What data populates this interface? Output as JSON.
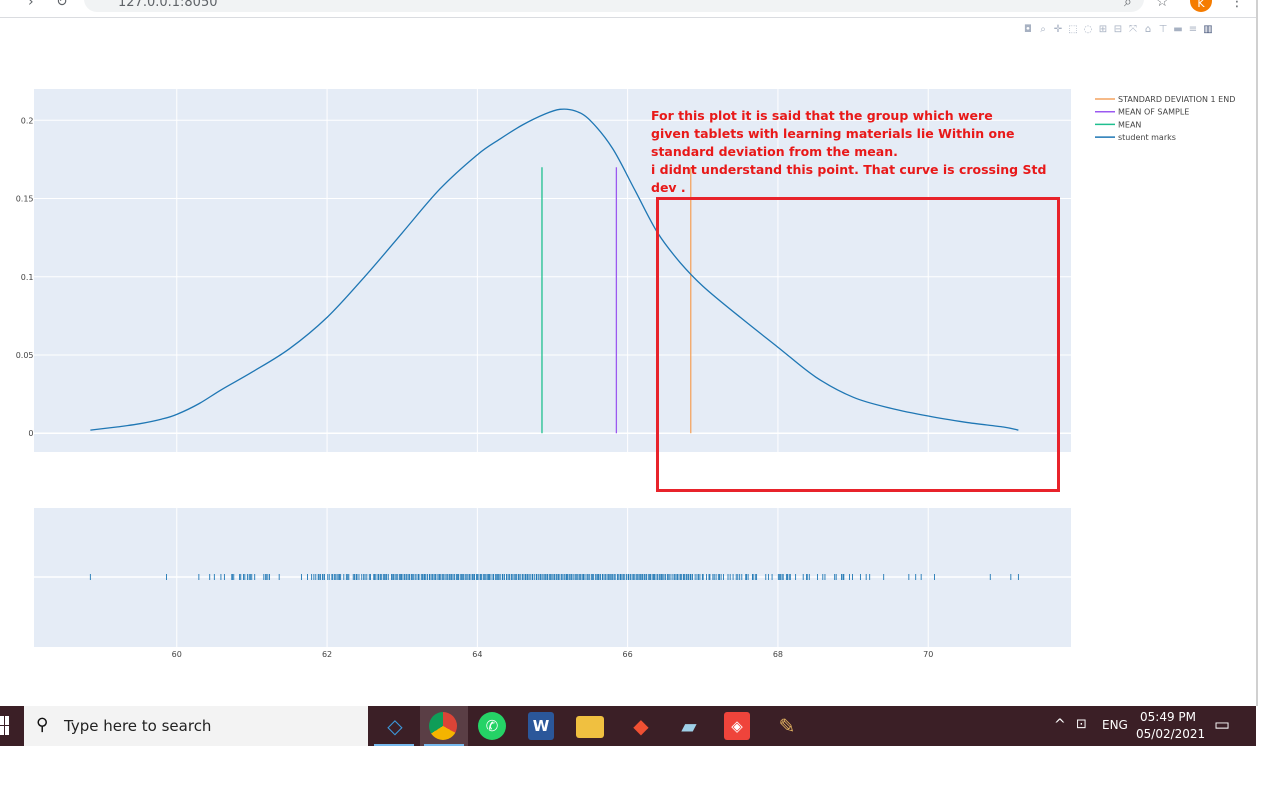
{
  "browser": {
    "address": "127.0.0.1:8050",
    "profile_initial": "K"
  },
  "modebar": [
    "camera-icon",
    "zoom-icon",
    "pan-icon",
    "box-select-icon",
    "lasso-icon",
    "zoom-in-icon",
    "zoom-out-icon",
    "autoscale-icon",
    "reset-axes-icon",
    "spike-lines-icon",
    "hover-closest-icon",
    "hover-compare-icon",
    "plotly-logo-icon"
  ],
  "legend": [
    {
      "label": "STANDARD DEVIATION 1 END",
      "color": "#f4a460"
    },
    {
      "label": "MEAN OF SAMPLE",
      "color": "#9b59f0"
    },
    {
      "label": "MEAN",
      "color": "#1fbf8f"
    },
    {
      "label": "student marks",
      "color": "#1f77b4"
    }
  ],
  "annotation": {
    "lines": [
      "For this plot it is said that  the group which were",
      "given tablets with learning materials lie Within one",
      "standard deviation from the mean.",
      "i didnt understand this point. That curve is crossing Std",
      "dev ."
    ],
    "color": "#e8232b"
  },
  "chart_data": {
    "type": "line",
    "xlim": [
      58.1,
      71.9
    ],
    "ylim": [
      -0.012,
      0.22
    ],
    "x_ticks": [
      60,
      62,
      64,
      66,
      68,
      70
    ],
    "y_ticks": [
      0,
      0.05,
      0.1,
      0.15,
      0.2
    ],
    "y_tick_labels": [
      "0",
      "0.05",
      "0.1",
      "0.15",
      "0.2"
    ],
    "x_tick_labels": [
      "60",
      "62",
      "64",
      "66",
      "68",
      "70"
    ],
    "series": [
      {
        "name": "student marks",
        "color": "#1f77b4",
        "x": [
          58.85,
          59.2,
          59.5,
          59.8,
          60.0,
          60.3,
          60.6,
          61.0,
          61.5,
          62.0,
          62.5,
          63.0,
          63.5,
          64.0,
          64.3,
          64.6,
          64.9,
          65.1,
          65.3,
          65.5,
          65.8,
          66.1,
          66.4,
          66.7,
          67.0,
          67.5,
          68.0,
          68.5,
          69.0,
          69.5,
          70.0,
          70.5,
          71.0,
          71.2
        ],
        "y": [
          0.002,
          0.004,
          0.006,
          0.009,
          0.012,
          0.019,
          0.028,
          0.039,
          0.054,
          0.074,
          0.1,
          0.128,
          0.156,
          0.178,
          0.188,
          0.197,
          0.204,
          0.207,
          0.206,
          0.2,
          0.182,
          0.155,
          0.128,
          0.109,
          0.094,
          0.074,
          0.055,
          0.036,
          0.023,
          0.016,
          0.011,
          0.007,
          0.004,
          0.002
        ]
      },
      {
        "name": "MEAN",
        "color": "#1fbf8f",
        "type": "vline",
        "x": 64.86,
        "y": [
          0,
          0.17
        ]
      },
      {
        "name": "MEAN OF SAMPLE",
        "color": "#9b59f0",
        "type": "vline",
        "x": 65.85,
        "y": [
          0,
          0.17
        ]
      },
      {
        "name": "STANDARD DEVIATION 1 END",
        "color": "#f4a460",
        "type": "vline",
        "x": 66.84,
        "y": [
          0,
          0.17
        ]
      }
    ],
    "rug": {
      "name": "student marks",
      "color": "#1f77b4",
      "x_range": [
        58.85,
        71.2
      ]
    }
  },
  "taskbar": {
    "search_placeholder": "Type here to search",
    "apps": [
      "vscode-icon",
      "chrome-icon",
      "whatsapp-icon",
      "word-icon",
      "file-explorer-icon",
      "git-icon",
      "notepad-icon",
      "anydesk-icon",
      "paint-icon"
    ],
    "lang": "ENG",
    "time": "05:49 PM",
    "date": "05/02/2021"
  }
}
